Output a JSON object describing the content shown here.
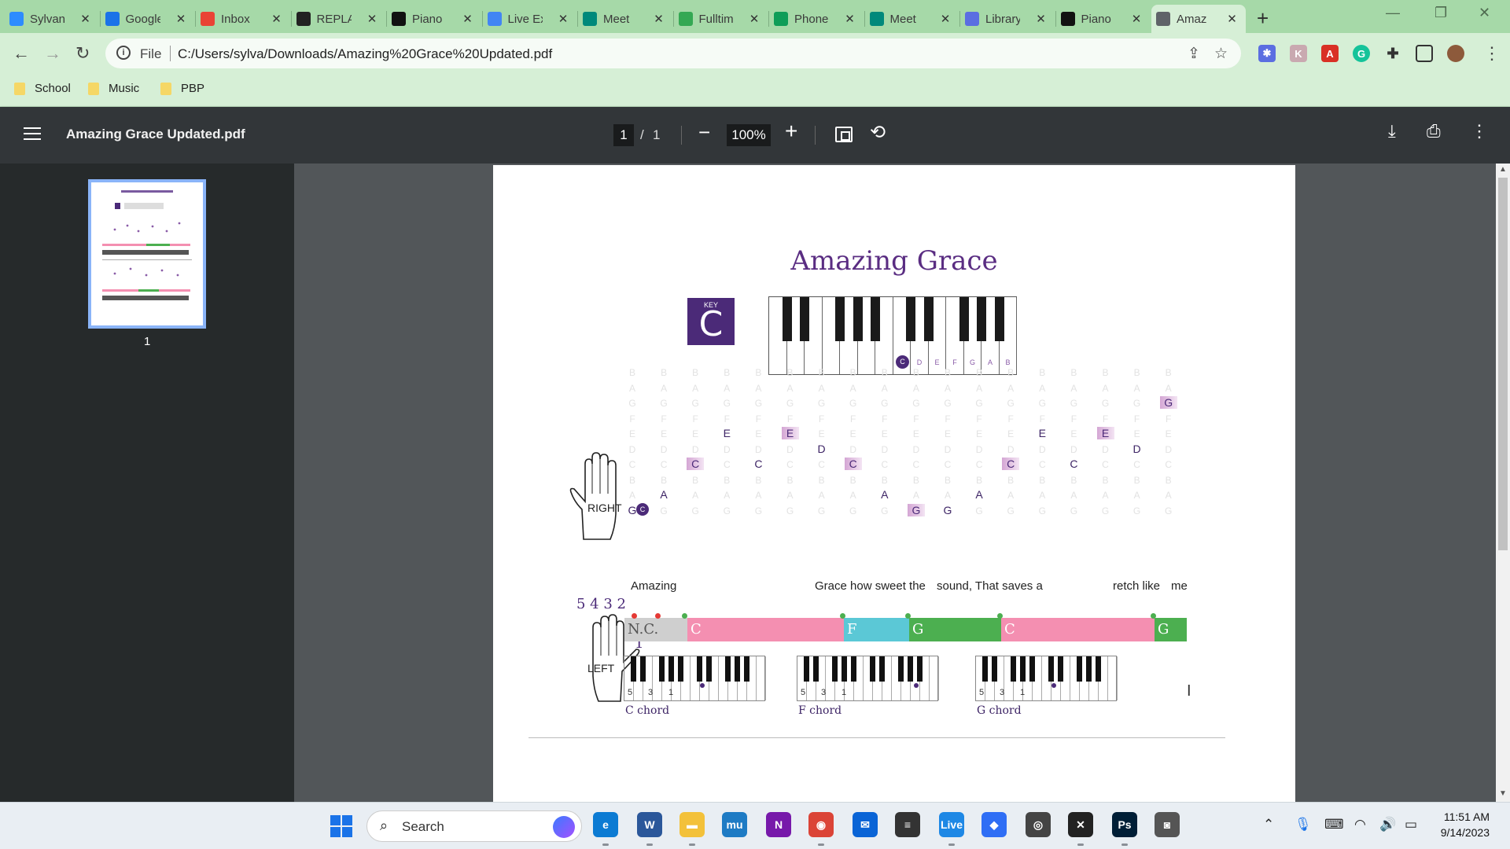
{
  "browser": {
    "tabs": [
      {
        "label": "Sylvan",
        "icon": "zoom-icon",
        "color": "#2d8cff"
      },
      {
        "label": "Google",
        "icon": "calendar-icon",
        "color": "#1a73e8"
      },
      {
        "label": "Inbox",
        "icon": "gmail-icon",
        "color": "#ea4335"
      },
      {
        "label": "REPLAY",
        "icon": "replay-icon",
        "color": "#222222"
      },
      {
        "label": "Piano",
        "icon": "piano-icon",
        "color": "#111111"
      },
      {
        "label": "Live Ex",
        "icon": "docs-icon",
        "color": "#4285f4"
      },
      {
        "label": "Meet",
        "icon": "meet-icon",
        "color": "#00897b"
      },
      {
        "label": "Fulltime",
        "icon": "maps-icon",
        "color": "#34a853"
      },
      {
        "label": "Phone",
        "icon": "sheets-icon",
        "color": "#0f9d58"
      },
      {
        "label": "Meet",
        "icon": "meet-icon",
        "color": "#00897b"
      },
      {
        "label": "Library",
        "icon": "gear-icon",
        "color": "#5b6ee1"
      },
      {
        "label": "Piano",
        "icon": "piano-icon",
        "color": "#111111"
      },
      {
        "label": "Amaz",
        "icon": "globe-icon",
        "color": "#5f6368",
        "active": true
      }
    ],
    "new_tab": "+",
    "window_controls": {
      "minimize": "—",
      "maximize": "❐",
      "close": "✕"
    },
    "address": {
      "scheme_label": "File",
      "url": "C:/Users/sylva/Downloads/Amazing%20Grace%20Updated.pdf"
    },
    "bookmarks": [
      "School",
      "Music",
      "PBP"
    ]
  },
  "pdf_viewer": {
    "title": "Amazing Grace Updated.pdf",
    "page_current": "1",
    "page_separator": "/",
    "page_total": "1",
    "zoom": "100%",
    "thumbnail_page": "1"
  },
  "sheet": {
    "title": "Amazing Grace",
    "key_label": "KEY",
    "key_value": "C",
    "keyboard_labels": [
      "C",
      "D",
      "E",
      "F",
      "G",
      "A",
      "B"
    ],
    "right_hand_label": "RIGHT",
    "right_hand_dot": "C",
    "left_hand_label": "LEFT",
    "finger_numbers": "5 4 3 2",
    "finger_one": "1",
    "grid_letters": [
      "B",
      "A",
      "G",
      "F",
      "E",
      "D",
      "C",
      "B",
      "A",
      "G"
    ],
    "notes": [
      {
        "col": 0,
        "row": 9,
        "text": "G"
      },
      {
        "col": 1,
        "row": 8,
        "text": "A"
      },
      {
        "col": 2,
        "row": 6,
        "text": "C",
        "highlight": true
      },
      {
        "col": 3,
        "row": 4,
        "text": "E"
      },
      {
        "col": 4,
        "row": 6,
        "text": "C"
      },
      {
        "col": 5,
        "row": 4,
        "text": "E",
        "highlight": true
      },
      {
        "col": 6,
        "row": 5,
        "text": "D"
      },
      {
        "col": 7,
        "row": 6,
        "text": "C",
        "highlight": true
      },
      {
        "col": 8,
        "row": 8,
        "text": "A"
      },
      {
        "col": 9,
        "row": 9,
        "text": "G",
        "highlight": true
      },
      {
        "col": 10,
        "row": 9,
        "text": "G"
      },
      {
        "col": 11,
        "row": 8,
        "text": "A"
      },
      {
        "col": 12,
        "row": 6,
        "text": "C",
        "highlight": true
      },
      {
        "col": 13,
        "row": 4,
        "text": "E"
      },
      {
        "col": 14,
        "row": 6,
        "text": "C"
      },
      {
        "col": 15,
        "row": 4,
        "text": "E",
        "highlight": true
      },
      {
        "col": 16,
        "row": 5,
        "text": "D"
      },
      {
        "col": 17,
        "row": 2,
        "text": "G",
        "highlight": true
      }
    ],
    "lyrics": [
      "Amazing",
      "Grace how sweet the",
      "sound, That saves a",
      "retch like",
      "me"
    ],
    "chords": [
      {
        "label": "N.C.",
        "color": "#cfcfcf",
        "text_color": "#555555"
      },
      {
        "label": "C",
        "color": "#f48fb1",
        "text_color": "#ffffff"
      },
      {
        "label": "F",
        "color": "#5bc8d6",
        "text_color": "#ffffff"
      },
      {
        "label": "G",
        "color": "#4caf50",
        "text_color": "#ffffff"
      },
      {
        "label": "C",
        "color": "#f48fb1",
        "text_color": "#ffffff"
      },
      {
        "label": "G",
        "color": "#4caf50",
        "text_color": "#ffffff"
      }
    ],
    "chord_diagrams": [
      {
        "name": "C chord",
        "fingers": [
          "5",
          "3",
          "1"
        ]
      },
      {
        "name": "F chord",
        "fingers": [
          "5",
          "3",
          "1"
        ]
      },
      {
        "name": "G chord",
        "fingers": [
          "5",
          "3",
          "1"
        ]
      }
    ]
  },
  "taskbar": {
    "search_placeholder": "Search",
    "apps": [
      {
        "name": "edge-icon",
        "color": "#0c7bd3",
        "glyph": "e"
      },
      {
        "name": "word-icon",
        "color": "#2b579a",
        "glyph": "W"
      },
      {
        "name": "file-explorer-icon",
        "color": "#f3c13a",
        "glyph": "▬"
      },
      {
        "name": "musescore-icon",
        "color": "#1e7bc4",
        "glyph": "mu"
      },
      {
        "name": "onenote-icon",
        "color": "#7719aa",
        "glyph": "N"
      },
      {
        "name": "chrome-icon",
        "color": "#db4437",
        "glyph": "◉"
      },
      {
        "name": "mail-icon",
        "color": "#0a64d6",
        "glyph": "✉"
      },
      {
        "name": "settings-icon",
        "color": "#333333",
        "glyph": "≡"
      },
      {
        "name": "live-icon",
        "color": "#1e88e5",
        "glyph": "Live"
      },
      {
        "name": "droplet-icon",
        "color": "#2f6ef5",
        "glyph": "◆"
      },
      {
        "name": "obs-icon",
        "color": "#444444",
        "glyph": "◎"
      },
      {
        "name": "capcut-icon",
        "color": "#222222",
        "glyph": "✕"
      },
      {
        "name": "photoshop-icon",
        "color": "#001e36",
        "glyph": "Ps"
      },
      {
        "name": "camera-icon",
        "color": "#555555",
        "glyph": "◙"
      }
    ],
    "time": "11:51 AM",
    "date": "9/14/2023"
  }
}
